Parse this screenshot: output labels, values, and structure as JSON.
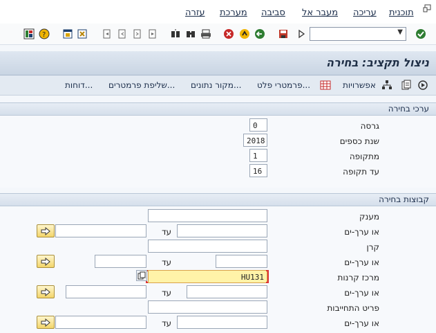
{
  "menu": {
    "items": [
      "תוכנית",
      "עריכה",
      "מעבר אל",
      "סביבה",
      "מערכת",
      "עזרה"
    ]
  },
  "toolbar": {
    "command_value": "",
    "icons": [
      "back-icon",
      "save-icon",
      "back-nav-icon",
      "exit-icon",
      "cancel-icon",
      "print-icon",
      "find-icon",
      "find-next-icon",
      "first-page-icon",
      "prev-page-icon",
      "next-page-icon",
      "last-page-icon",
      "new-session-icon",
      "shortcut-icon",
      "help-icon",
      "layout-icon"
    ]
  },
  "title": "ניצול תקציב: בחירה",
  "app_toolbar": {
    "items": [
      "אפשרויות",
      "פרמטרי פלט...",
      "מקור נתונים...",
      "שליפת פרמטרים...",
      "דוחות..."
    ]
  },
  "section1": {
    "header": "ערכי בחירה",
    "fields": [
      {
        "label": "גרסה",
        "value": "0"
      },
      {
        "label": "שנת כספים",
        "value": "2018"
      },
      {
        "label": "מתקופה",
        "value": "1"
      },
      {
        "label": "עד תקופה",
        "value": "16"
      }
    ]
  },
  "section2": {
    "header": "קבוצות בחירה",
    "or_values_label": "או ערך-ים",
    "to_label": "עד",
    "fields": [
      {
        "label": "מענק",
        "value": ""
      },
      {
        "label": "קרן",
        "value": ""
      },
      {
        "label": "מרכז קרנות",
        "value": "HU131"
      },
      {
        "label": "פריט התחייבות",
        "value": ""
      }
    ]
  },
  "colors": {
    "title_bg": "#c9d5e3",
    "highlight": "#fff3a8",
    "menu_text": "#1b2d4a"
  }
}
